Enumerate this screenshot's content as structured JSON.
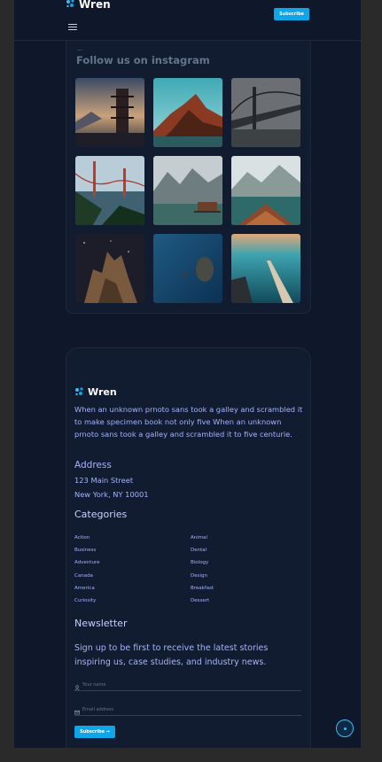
{
  "brand": {
    "name": "Wren",
    "accent": "#0ea5e9"
  },
  "header": {
    "subscribe_label": "Subscribe",
    "menu_icon": "hamburger-icon"
  },
  "instagram": {
    "eyebrow": "...",
    "title": "Follow us on instagram",
    "photos": [
      "pagoda-sunset",
      "mountain-peaks-sunset",
      "bridge-fog",
      "golden-gate-bridge",
      "alpine-lake-cabin",
      "canoe-lake",
      "rock-formation-night-sky",
      "ocean-rock-aerial",
      "coastal-pier-sunset"
    ]
  },
  "footer": {
    "brand": "Wren",
    "description": "When an unknown prnoto sans took a galley and scrambled it to make specimen book not only five When an unknown prnoto sans took a galley and scrambled it to five centurie.",
    "address_title": "Address",
    "address_line1": "123 Main Street",
    "address_line2": "New York, NY 10001",
    "categories_title": "Categories",
    "categories_left": [
      "Action",
      "Business",
      "Adventure",
      "Canada",
      "America",
      "Curiosity"
    ],
    "categories_right": [
      "Animal",
      "Dental",
      "Biology",
      "Design",
      "Breakfast",
      "Dessert"
    ],
    "newsletter_title": "Newsletter",
    "newsletter_desc": "Sign up to be first to receive the latest stories inspiring us, case studies, and industry news.",
    "name_placeholder": "Your name",
    "email_placeholder": "Email address",
    "subscribe_label": "Subscribe →"
  },
  "scroll_top_icon": "arrow-up-icon"
}
